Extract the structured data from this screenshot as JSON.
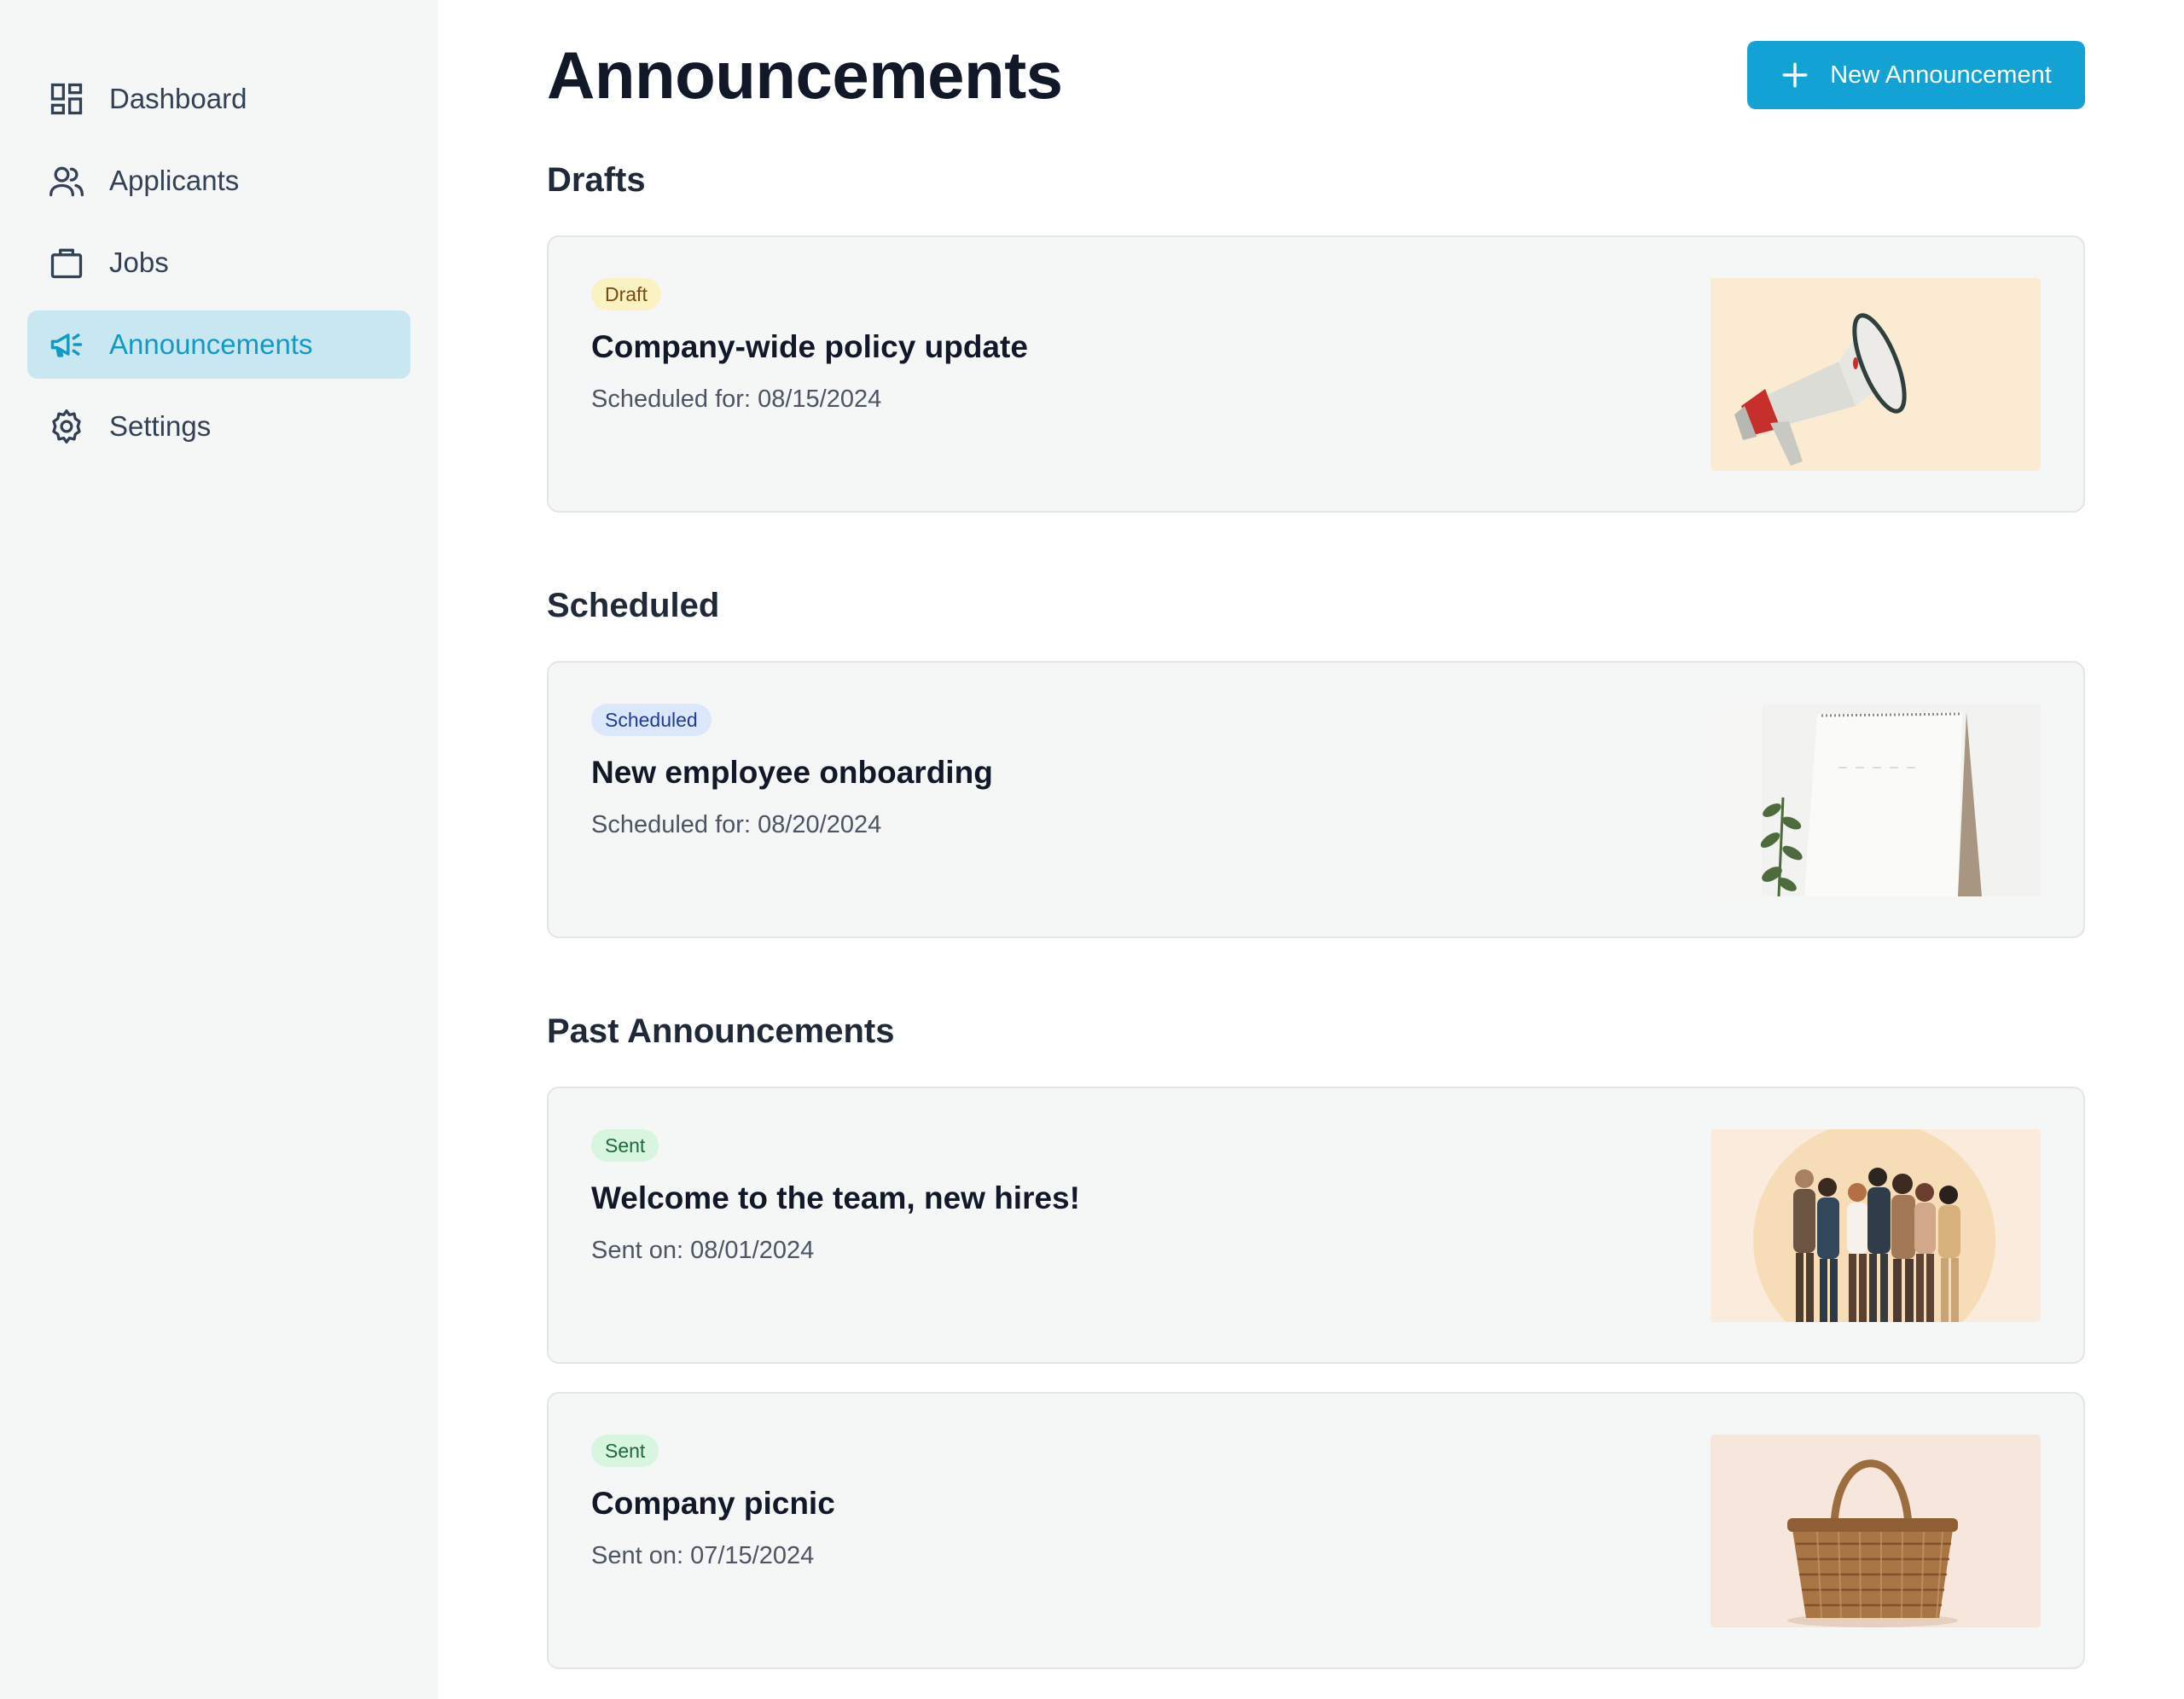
{
  "sidebar": {
    "items": [
      {
        "label": "Dashboard",
        "icon": "dashboard-icon"
      },
      {
        "label": "Applicants",
        "icon": "users-icon"
      },
      {
        "label": "Jobs",
        "icon": "briefcase-icon"
      },
      {
        "label": "Announcements",
        "icon": "megaphone-icon",
        "active": true
      },
      {
        "label": "Settings",
        "icon": "gear-icon"
      }
    ]
  },
  "header": {
    "title": "Announcements",
    "new_button_label": "New Announcement"
  },
  "sections": {
    "drafts": {
      "title": "Drafts",
      "cards": [
        {
          "badge": "Draft",
          "title": "Company-wide policy update",
          "date": "Scheduled for: 08/15/2024",
          "image": "megaphone-image"
        }
      ]
    },
    "scheduled": {
      "title": "Scheduled",
      "cards": [
        {
          "badge": "Scheduled",
          "title": "New employee onboarding",
          "date": "Scheduled for: 08/20/2024",
          "image": "calendar-plant-image"
        }
      ]
    },
    "past": {
      "title": "Past Announcements",
      "cards": [
        {
          "badge": "Sent",
          "title": "Welcome to the team, new hires!",
          "date": "Sent on: 08/01/2024",
          "image": "team-people-image"
        },
        {
          "badge": "Sent",
          "title": "Company picnic",
          "date": "Sent on: 07/15/2024",
          "image": "picnic-basket-image"
        }
      ]
    }
  },
  "colors": {
    "accent": "#12a2d3",
    "sidebar_active_bg": "#c9e7f1",
    "sidebar_active_text": "#139ac4",
    "sidebar_bg": "#f5f6f6"
  }
}
